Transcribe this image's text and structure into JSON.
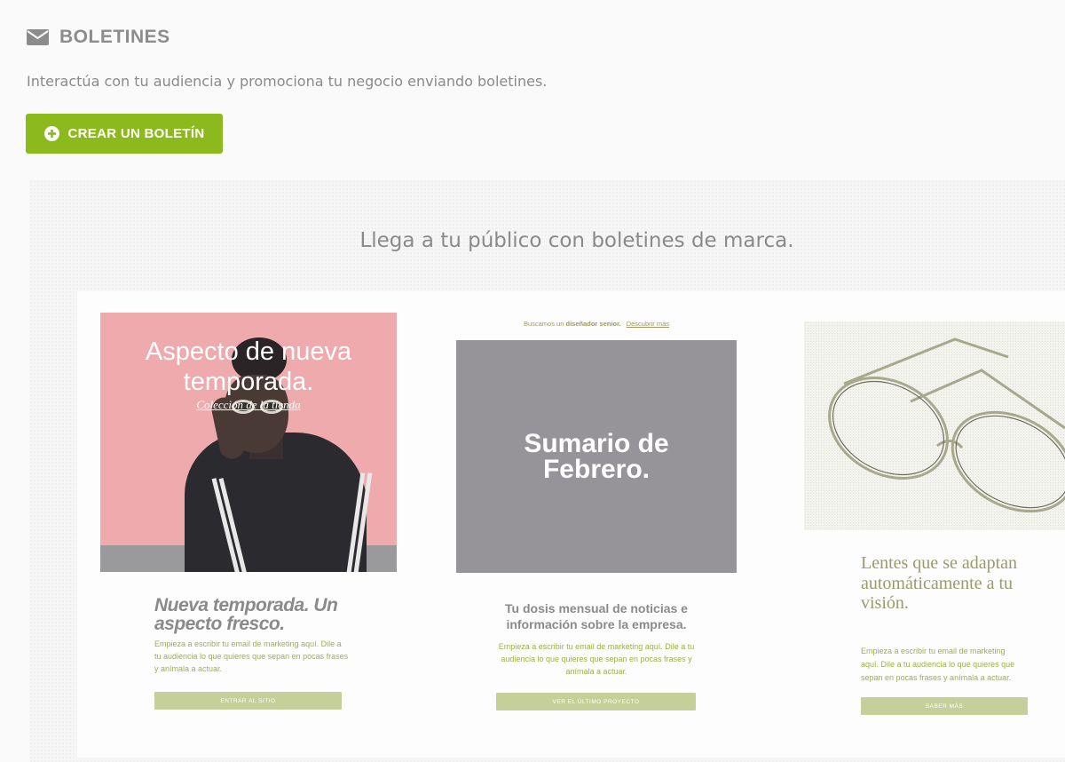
{
  "header": {
    "title": "BOLETINES",
    "icon": "envelope-icon",
    "description": "Interactúa con tu audiencia y promociona tu negocio enviando boletines."
  },
  "actions": {
    "create_label": "CREAR UN BOLETÍN",
    "create_icon": "plus-circle-icon",
    "accent_color": "#8cba1d"
  },
  "showcase": {
    "tagline": "Llega a tu público con boletines de marca.",
    "cards": [
      {
        "image_headline": "Aspecto de nueva temporada.",
        "image_subtitle": "Colección de la tienda",
        "title": "Nueva temporada. Un aspecto fresco.",
        "body": "Empieza a escribir tu email de marketing aquí. Dile a tu audiencia lo que quieres que sepan en pocas frases y anímala a actuar.",
        "button": "ENTRAR AL SITIO"
      },
      {
        "top_text": "Buscamos un",
        "top_bold": "diseñador senior.",
        "top_link": "Descubrir más",
        "image_headline": "Sumario de Febrero.",
        "title": "Tu dosis mensual de noticias e información sobre la empresa.",
        "body": "Empieza a escribir tu email de marketing aquí. Dile a tu audiencia lo que quieres que sepan en pocas frases y anímala a actuar.",
        "button": "VER EL ÚLTIMO PROYECTO"
      },
      {
        "image": "eyeglasses",
        "title": "Lentes que se adaptan automáticamente a tu visión.",
        "body": "Empieza a escribir tu email de marketing aquí. Dile a tu audiencia lo que quieres que sepan en pocas frases y anímala a actuar.",
        "button": "SABER MÁS"
      }
    ]
  }
}
